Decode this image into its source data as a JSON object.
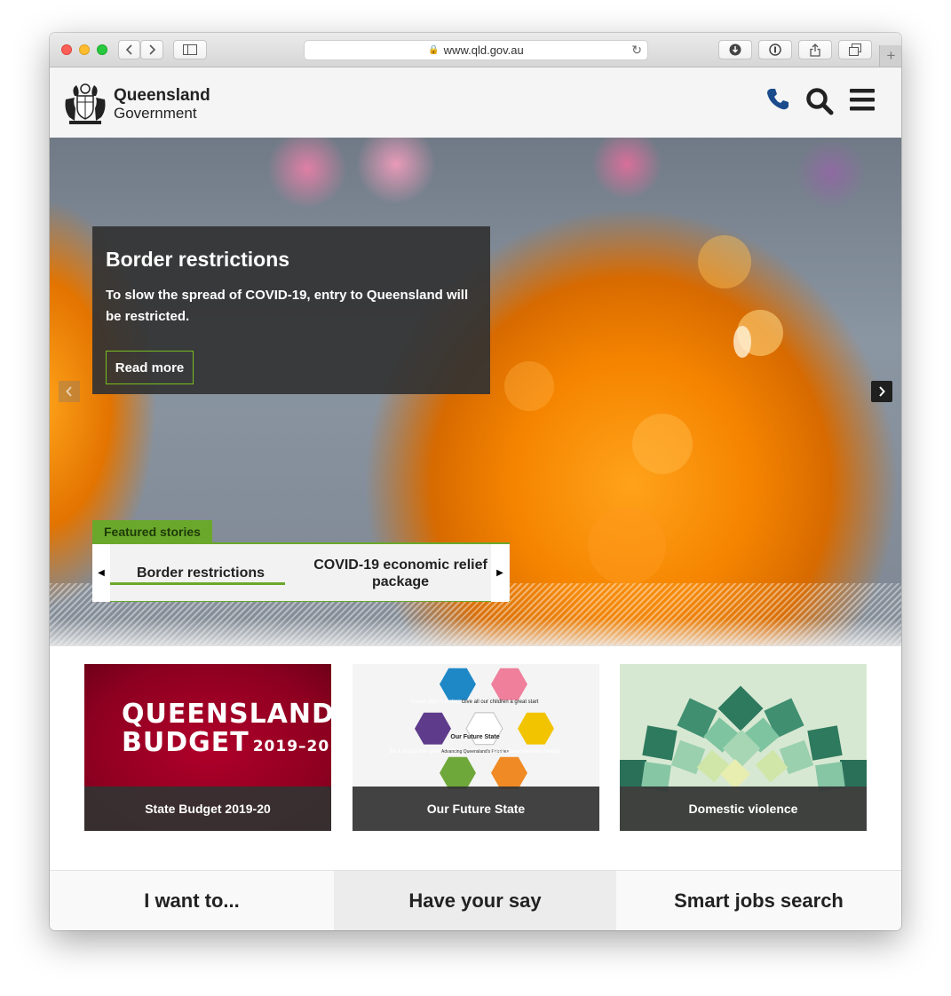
{
  "browser": {
    "url": "www.qld.gov.au",
    "new_tab_label": "+"
  },
  "header": {
    "logo_line1": "Queensland",
    "logo_line2": "Government"
  },
  "hero": {
    "title": "Border restrictions",
    "description": "To slow the spread of COVID-19, entry to Queensland will be restricted.",
    "read_more_label": "Read more"
  },
  "featured": {
    "label": "Featured stories",
    "items": [
      "Border restrictions",
      "COVID-19 economic relief package"
    ],
    "active_index": 0
  },
  "cards": [
    {
      "caption": "State Budget 2019-20",
      "image_line1": "QUEENSLAND",
      "image_line2": "BUDGET",
      "image_year": "2019–20"
    },
    {
      "caption": "Our Future State",
      "hex_labels": [
        "Create jobs in a strong economy",
        "Give all our children a great start",
        "Be a responsive government",
        "Our Future State",
        "Advancing Queensland's Priorities",
        "Keep Queenslanders healthy"
      ]
    },
    {
      "caption": "Domestic violence"
    }
  ],
  "tiles": [
    "I want to...",
    "Have your say",
    "Smart jobs search"
  ],
  "colors": {
    "accent_green": "#6aa82b",
    "budget_red": "#a0002a",
    "header_blue": "#1a4b8c"
  }
}
